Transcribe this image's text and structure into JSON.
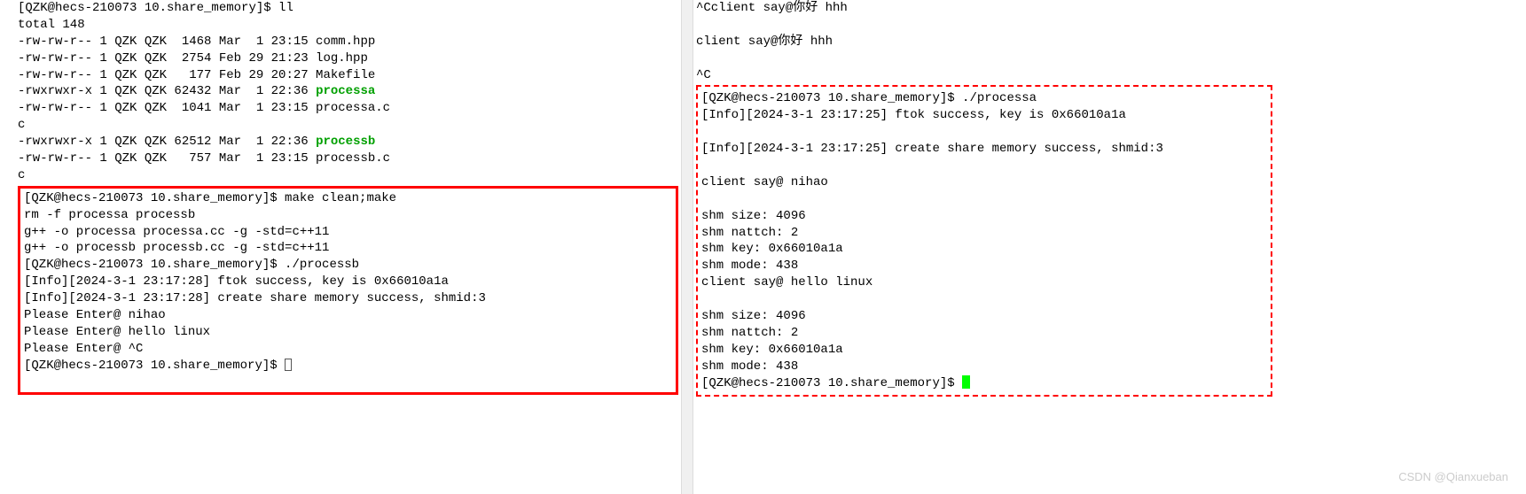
{
  "left": {
    "top": [
      "[QZK@hecs-210073 10.share_memory]$ ll",
      "total 148",
      "-rw-rw-r-- 1 QZK QZK  1468 Mar  1 23:15 comm.hpp",
      "-rw-rw-r-- 1 QZK QZK  2754 Feb 29 21:23 log.hpp",
      "-rw-rw-r-- 1 QZK QZK   177 Feb 29 20:27 Makefile"
    ],
    "exec_a_prefix": "-rwxrwxr-x 1 QZK QZK 62432 Mar  1 22:36 ",
    "exec_a_name": "processa",
    "mid1": "-rw-rw-r-- 1 QZK QZK  1041 Mar  1 23:15 processa.c",
    "mid1b": "c",
    "exec_b_prefix": "-rwxrwxr-x 1 QZK QZK 62512 Mar  1 22:36 ",
    "exec_b_name": "processb",
    "mid2": "-rw-rw-r-- 1 QZK QZK   757 Mar  1 23:15 processb.c",
    "mid2b": "c",
    "box": [
      "[QZK@hecs-210073 10.share_memory]$ make clean;make",
      "rm -f processa processb",
      "g++ -o processa processa.cc -g -std=c++11",
      "g++ -o processb processb.cc -g -std=c++11",
      "[QZK@hecs-210073 10.share_memory]$ ./processb",
      "[Info][2024-3-1 23:17:28] ftok success, key is 0x66010a1a",
      "",
      "[Info][2024-3-1 23:17:28] create share memory success, shmid:3",
      "",
      "Please Enter@ nihao",
      "Please Enter@ hello linux",
      "Please Enter@ ^C"
    ],
    "box_prompt": "[QZK@hecs-210073 10.share_memory]$ "
  },
  "right": {
    "top": [
      "^Cclient say@你好 hhh",
      "",
      "client say@你好 hhh",
      "",
      "^C"
    ],
    "box": [
      "[QZK@hecs-210073 10.share_memory]$ ./processa",
      "[Info][2024-3-1 23:17:25] ftok success, key is 0x66010a1a",
      "",
      "[Info][2024-3-1 23:17:25] create share memory success, shmid:3",
      "",
      "client say@ nihao",
      "",
      "shm size: 4096",
      "shm nattch: 2",
      "shm key: 0x66010a1a",
      "shm mode: 438",
      "client say@ hello linux",
      "",
      "shm size: 4096",
      "shm nattch: 2",
      "shm key: 0x66010a1a",
      "shm mode: 438"
    ],
    "box_prompt": "[QZK@hecs-210073 10.share_memory]$ "
  },
  "watermark": "CSDN @Qianxueban"
}
